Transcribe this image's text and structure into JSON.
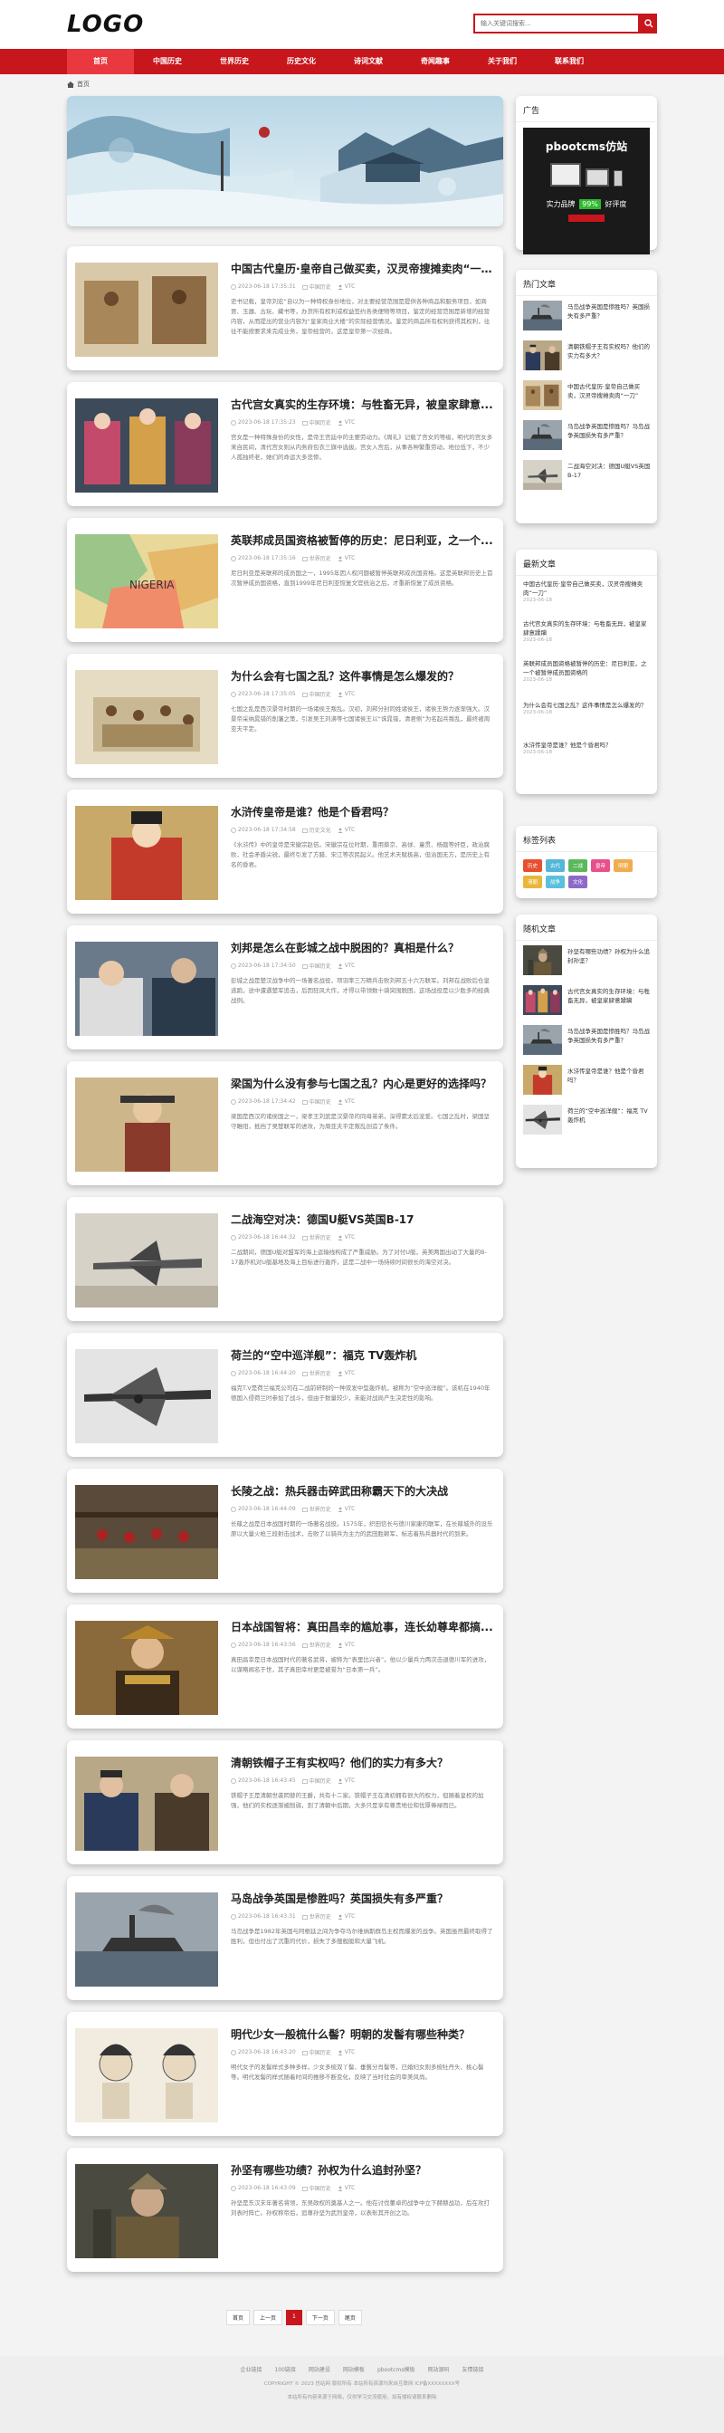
{
  "header": {
    "logo": "LOGO",
    "search_placeholder": "输入关键词搜索..."
  },
  "nav": [
    "首页",
    "中国历史",
    "世界历史",
    "历史文化",
    "诗词文献",
    "奇闻趣事",
    "关于我们",
    "联系我们"
  ],
  "breadcrumb": "首页",
  "articles": [
    {
      "title": "中国古代皇历·皇帝自己做买卖，汉灵帝搜摊卖肉“一刀...",
      "date": "2023-06-18 17:35:31",
      "category": "中国历史",
      "author": "VTC",
      "desc": "史书记载，皇帝刘宏“自以为一种特权身份地位，对主要经营范围是提供各种商品和服务项目，如商贾、玉器、古玩、藏书等，办货所有权利或权益签约各类便物等项目，鉴定的经营范围是新增的经营内容，从而提出的营业内容为“皇家商业大楼”的实际经营情况。鉴定的商品所有权利获得其权利，往往不能按要求来完成业务，皇帝经营的，这是皇帝第一次经商。",
      "img": "a"
    },
    {
      "title": "古代宫女真实的生存环境：与牲畜无异，被皇家肆意...",
      "date": "2023-06-18 17:35:23",
      "category": "中国历史",
      "author": "VTC",
      "desc": "宫女是一种特殊身份的女性，是帝王宫廷中的主要劳动力。《周礼》记载了宫女的等级，明代的宫女多来自民间，清代宫女则从内务府包衣三旗中选拔。宫女入宫后，从事各种繁重劳动，地位低下，不少人孤独终老，她们的命运大多悲惨。",
      "img": "b"
    },
    {
      "title": "英联邦成员国资格被暂停的历史：尼日利亚，之一个...",
      "date": "2023-06-18 17:35:16",
      "category": "世界历史",
      "author": "VTC",
      "desc": "尼日利亚是英联邦的成员国之一，1995年因人权问题被暂停英联邦成员国资格。这是英联邦历史上首次暂停成员国资格，直到1999年尼日利亚恢复文官统治之后，才重新恢复了成员资格。",
      "img": "c"
    },
    {
      "title": "为什么会有七国之乱？这件事情是怎么爆发的？",
      "date": "2023-06-18 17:35:05",
      "category": "中国历史",
      "author": "VTC",
      "desc": "七国之乱是西汉景帝时期的一场诸侯王叛乱。汉初，刘邦分封同姓诸侯王，诸侯王势力逐渐强大。汉景帝采纳晁错的削藩之策，引发吴王刘濞等七国诸侯王以“诛晁错，清君侧”为名起兵叛乱，最终被周亚夫平定。",
      "img": "d"
    },
    {
      "title": "水浒传皇帝是谁？他是个昏君吗？",
      "date": "2023-06-18 17:34:58",
      "category": "历史文化",
      "author": "VTC",
      "desc": "《水浒传》中的皇帝是宋徽宗赵佶。宋徽宗在位时期，重用蔡京、高俅、童贯、杨戬等奸臣，政治腐败，社会矛盾尖锐，最终引发了方腊、宋江等农民起义。他艺术天赋极高，但治国无方，是历史上有名的昏君。",
      "img": "e"
    },
    {
      "title": "刘邦是怎么在彭城之战中脱困的？真相是什么？",
      "date": "2023-06-18 17:34:50",
      "category": "中国历史",
      "author": "VTC",
      "desc": "彭城之战是楚汉战争中的一场著名战役，项羽率三万精兵击败刘邦五十六万联军。刘邦在战败后仓皇逃跑，途中遭遇楚军追击，后因狂风大作，才得以带领数十骑突围脱困，这场战役是以少胜多的经典战例。",
      "img": "f"
    },
    {
      "title": "梁国为什么没有参与七国之乱？内心是更好的选择吗？",
      "date": "2023-06-18 17:34:42",
      "category": "中国历史",
      "author": "VTC",
      "desc": "梁国是西汉的诸侯国之一，梁孝王刘武是汉景帝的同母弟弟，深得窦太后宠爱。七国之乱时，梁国坚守睢阳，抵挡了吴楚联军的进攻，为周亚夫平定叛乱创造了条件。",
      "img": "g"
    },
    {
      "title": "二战海空对决：德国U艇VS英国B-17",
      "date": "2023-06-18 16:44:32",
      "category": "世界历史",
      "author": "VTC",
      "desc": "二战期间，德国U艇对盟军的海上运输线构成了严重威胁。为了对付U艇，英美两国出动了大量的B-17轰炸机对U艇基地及海上目标进行轰炸，这是二战中一场持续时间很长的海空对决。",
      "img": "h"
    },
    {
      "title": "荷兰的“空中巡洋舰”：福克 TV轰炸机",
      "date": "2023-06-18 16:44:20",
      "category": "世界历史",
      "author": "VTC",
      "desc": "福克T.V是荷兰福克公司在二战前研制的一种双发中型轰炸机，被称为“空中巡洋舰”。该机在1940年德国入侵荷兰时参加了战斗，但由于数量较少，未能对战局产生决定性的影响。",
      "img": "i"
    },
    {
      "title": "长陵之战：热兵器击碎武田称霸天下的大决战",
      "date": "2023-06-18 16:44:09",
      "category": "世界历史",
      "author": "VTC",
      "desc": "长篠之战是日本战国时期的一场著名战役。1575年，织田信长与德川家康的联军，在长篠城外的设乐原以大量火枪三段射击战术，击败了以骑兵为主力的武田胜赖军，标志着热兵器时代的到来。",
      "img": "j"
    },
    {
      "title": "日本战国智将：真田昌幸的尴尬事，连长幼尊卑都搞...",
      "date": "2023-06-18 16:43:56",
      "category": "世界历史",
      "author": "VTC",
      "desc": "真田昌幸是日本战国时代的著名武将，被称为“表里比兴者”。他以少量兵力两次击退德川军的进攻，以谋略闻名于世，其子真田幸村更是被誉为“日本第一兵”。",
      "img": "k"
    },
    {
      "title": "清朝铁帽子王有实权吗？他们的实力有多大？",
      "date": "2023-06-18 16:43:45",
      "category": "中国历史",
      "author": "VTC",
      "desc": "铁帽子王是清朝世袭罔替的王爵，共有十二家。铁帽子王在清初拥有很大的权力，但随着皇权的加强，他们的实权逐渐被削弱，到了清朝中后期，大多只是享有尊贵地位和优厚俸禄而已。",
      "img": "l"
    },
    {
      "title": "马岛战争英国是惨胜吗？英国损失有多严重？",
      "date": "2023-06-18 16:43:31",
      "category": "世界历史",
      "author": "VTC",
      "desc": "马岛战争是1982年英国与阿根廷之间为争夺马尔维纳斯群岛主权而爆发的战争。英国虽然最终取得了胜利，但也付出了沉重的代价，损失了多艘舰艇和大量飞机。",
      "img": "m"
    },
    {
      "title": "明代少女一般梳什么髻？明朝的发髻有哪些种类？",
      "date": "2023-06-18 16:43:20",
      "category": "中国历史",
      "author": "VTC",
      "desc": "明代女子的发髻样式多种多样，少女多梳双丫髻、垂鬟分肖髻等，已婚妇女则多梳牡丹头、桃心髻等。明代发髻的样式随着时间的推移不断变化，反映了当时社会的审美风尚。",
      "img": "n"
    },
    {
      "title": "孙坚有哪些功绩？孙权为什么追封孙坚？",
      "date": "2023-06-18 16:43:09",
      "category": "中国历史",
      "author": "VTC",
      "desc": "孙坚是东汉末年著名将领，东吴政权的奠基人之一。他在讨伐董卓的战争中立下赫赫战功，后在攻打刘表时阵亡。孙权称帝后，追尊孙坚为武烈皇帝，以表彰其开创之功。",
      "img": "o"
    }
  ],
  "pager": [
    "首页",
    "上一页",
    "1",
    "下一页",
    "尾页"
  ],
  "sidebar": {
    "ad_title": "广告",
    "ad_brand": "pbootcms仿站",
    "ad_line1": "实力品牌",
    "ad_highlight": "99%",
    "ad_line2": "好评度",
    "hot_title": "热门文章",
    "hot": [
      "马岛战争英国是惨胜吗？英国损失有多严重？",
      "清朝铁帽子王有实权吗？他们的实力有多大？",
      "中国古代皇历·皇帝自己做买卖，汉灵帝搜摊卖肉“一刀”",
      "马岛战争英国是惨胜吗？马岛战争英国损失有多严重？",
      "二战海空对决：德国U艇VS英国B-17"
    ],
    "latest_title": "最新文章",
    "latest": [
      {
        "t": "中国古代皇历·皇帝自己做买卖，汉灵帝搜摊卖肉“一刀”",
        "d": "2023-06-18"
      },
      {
        "t": "古代宫女真实的生存环境：与牲畜无异，被皇家肆意蹂躏",
        "d": "2023-06-18"
      },
      {
        "t": "英联邦成员国资格被暂停的历史：尼日利亚，之一个被暂停成员国资格的",
        "d": "2023-06-18"
      },
      {
        "t": "为什么会有七国之乱？这件事情是怎么爆发的？",
        "d": "2023-06-18"
      },
      {
        "t": "水浒传皇帝是谁？他是个昏君吗？",
        "d": "2023-06-18"
      }
    ],
    "tags_title": "标签列表",
    "tags": [
      {
        "t": "历史",
        "c": "#e6502f"
      },
      {
        "t": "古代",
        "c": "#53b7d8"
      },
      {
        "t": "二战",
        "c": "#5cb85c"
      },
      {
        "t": "皇帝",
        "c": "#e8508c"
      },
      {
        "t": "明朝",
        "c": "#f0ad4e"
      },
      {
        "t": "清朝",
        "c": "#e8b73a"
      },
      {
        "t": "战争",
        "c": "#5bc0de"
      },
      {
        "t": "文化",
        "c": "#8e6ac8"
      }
    ],
    "random_title": "随机文章",
    "random": [
      "孙坚有哪些功绩？孙权为什么追封孙坚？",
      "古代宫女真实的生存环境：与牲畜无异，被皇家肆意蹂躏",
      "马岛战争英国是惨胜吗？马岛战争英国损失有多严重？",
      "水浒传皇帝是谁？他是个昏君吗？",
      "荷兰的“空中巡洋舰”：福克 TV轰炸机"
    ]
  },
  "footer": {
    "links": [
      "企业链接",
      "100链接",
      "网站建设",
      "网站模板",
      "pbootcms模板",
      "网站源码",
      "友情链接"
    ],
    "copyright": "COPYRIGHT © 2023 仿站网 版权所有 本站所有资源均来自互联网 ICP备XXXXXXXX号",
    "notice": "本站所有内容来源于网络，仅供学习交流使用，如有侵权请联系删除"
  },
  "colors": {
    "primary": "#c8161d",
    "nav_active": "#e9383f",
    "bg": "#f3f3f3"
  }
}
